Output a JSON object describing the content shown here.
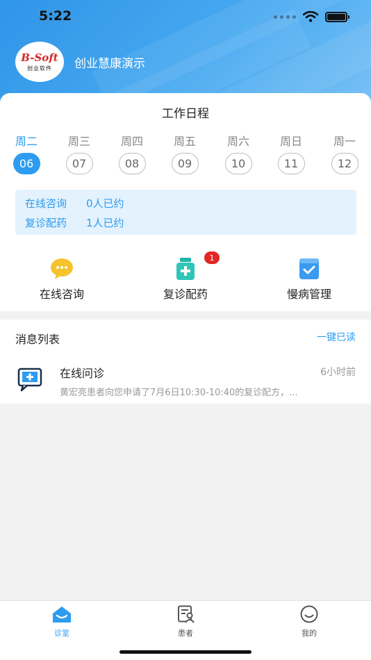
{
  "status_bar": {
    "time": "5:22"
  },
  "header": {
    "logo_text": "B-Soft",
    "logo_sub": "创业软件",
    "org_name": "创业慧康演示"
  },
  "schedule": {
    "title": "工作日程",
    "days": [
      {
        "weekday": "周二",
        "date": "06",
        "active": true
      },
      {
        "weekday": "周三",
        "date": "07",
        "active": false
      },
      {
        "weekday": "周四",
        "date": "08",
        "active": false
      },
      {
        "weekday": "周五",
        "date": "09",
        "active": false
      },
      {
        "weekday": "周六",
        "date": "10",
        "active": false
      },
      {
        "weekday": "周日",
        "date": "11",
        "active": false
      },
      {
        "weekday": "周一",
        "date": "12",
        "active": false
      }
    ],
    "appointments": [
      {
        "label": "在线咨询",
        "value": "0人已约"
      },
      {
        "label": "复诊配药",
        "value": "1人已约"
      }
    ]
  },
  "quick_actions": [
    {
      "label": "在线咨询",
      "icon": "chat-bubble-icon",
      "badge": ""
    },
    {
      "label": "复诊配药",
      "icon": "medicine-bottle-icon",
      "badge": "1"
    },
    {
      "label": "慢病管理",
      "icon": "clipboard-check-icon",
      "badge": ""
    }
  ],
  "messages": {
    "title": "消息列表",
    "mark_all_read": "一键已读",
    "items": [
      {
        "title": "在线问诊",
        "time": "6小时前",
        "text": "黄宏亮患者向您申请了7月6日10:30-10:40的复诊配方，..."
      }
    ]
  },
  "tabbar": {
    "tabs": [
      {
        "label": "诊室",
        "active": true
      },
      {
        "label": "患者",
        "active": false
      },
      {
        "label": "我的",
        "active": false
      }
    ]
  },
  "colors": {
    "accent": "#2d9cf0",
    "badge": "#e32626",
    "appointment_bg": "#e3f2fd"
  }
}
